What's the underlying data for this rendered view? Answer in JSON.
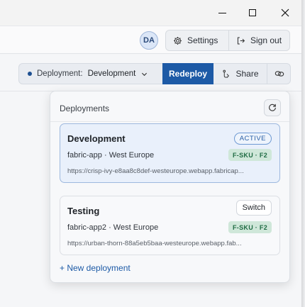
{
  "window": {
    "controls": {
      "minimize": "minimize-icon",
      "maximize": "maximize-icon",
      "close": "close-icon"
    }
  },
  "header": {
    "avatar_initials": "DA",
    "settings_label": "Settings",
    "signout_label": "Sign out"
  },
  "toolbar": {
    "deployment_label": "Deployment:",
    "deployment_value": "Development",
    "redeploy_label": "Redeploy",
    "share_label": "Share",
    "accent_color": "#1d5aa6"
  },
  "panel": {
    "title": "Deployments",
    "new_deployment_label": "+ New deployment",
    "cards": [
      {
        "name": "Development",
        "status": "ACTIVE",
        "subtitle": "fabric-app · West Europe",
        "sku": "F-SKU · F2",
        "url": "https://crisp-ivy-e8aa8c8def-westeurope.webapp.fabricap..."
      },
      {
        "name": "Testing",
        "action": "Switch",
        "subtitle": "fabric-app2 · West Europe",
        "sku": "F-SKU · F2",
        "url": "https://urban-thorn-88a5eb5baa-westeurope.webapp.fab..."
      }
    ]
  }
}
